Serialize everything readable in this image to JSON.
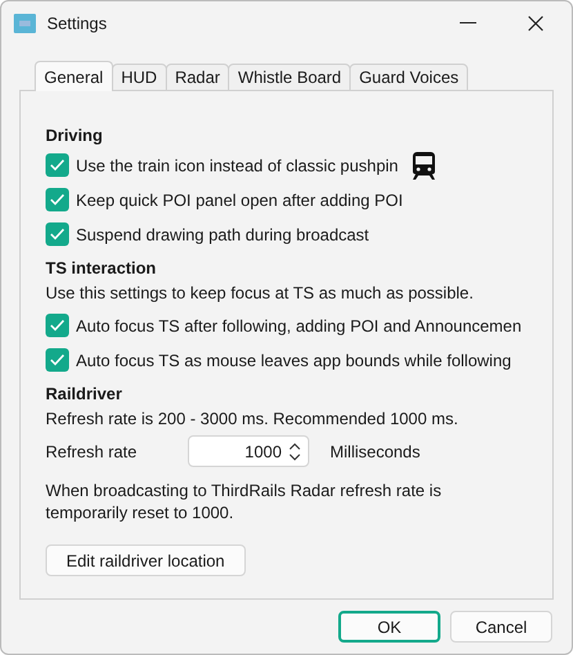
{
  "window": {
    "title": "Settings"
  },
  "tabs": [
    {
      "label": "General",
      "selected": true
    },
    {
      "label": "HUD",
      "selected": false
    },
    {
      "label": "Radar",
      "selected": false
    },
    {
      "label": "Whistle Board",
      "selected": false
    },
    {
      "label": "Guard Voices",
      "selected": false
    }
  ],
  "driving": {
    "heading": "Driving",
    "options": [
      {
        "label": "Use the train icon instead of classic pushpin",
        "checked": true,
        "trailing_icon": true
      },
      {
        "label": "Keep quick POI panel open after adding POI",
        "checked": true,
        "trailing_icon": false
      },
      {
        "label": "Suspend drawing path during broadcast",
        "checked": true,
        "trailing_icon": false
      }
    ]
  },
  "ts_interaction": {
    "heading": "TS interaction",
    "description": "Use this settings to keep focus at TS as much as possible.",
    "options": [
      {
        "label": "Auto focus TS after following, adding POI and Announcemen",
        "checked": true
      },
      {
        "label": "Auto focus TS as mouse leaves app bounds while following",
        "checked": true
      }
    ]
  },
  "raildriver": {
    "heading": "Raildriver",
    "description": "Refresh rate is 200 - 3000 ms. Recommended 1000 ms.",
    "refresh_label": "Refresh rate",
    "refresh_value": "1000",
    "unit": "Milliseconds",
    "note": "When broadcasting to ThirdRails Radar refresh rate is temporarily reset to 1000.",
    "button": "Edit raildriver location"
  },
  "buttons": [
    {
      "label": "OK",
      "default": true
    },
    {
      "label": "Cancel",
      "default": false
    }
  ]
}
